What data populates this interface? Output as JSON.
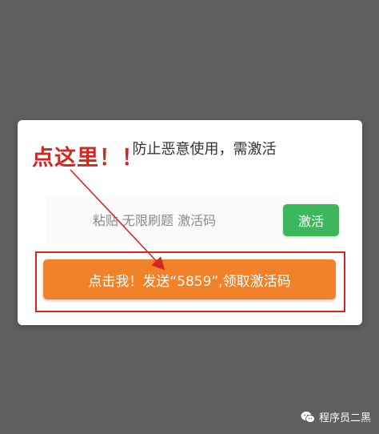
{
  "dialog": {
    "title": "防止恶意使用，需激活",
    "input_placeholder": "粘贴 无限刷题 激活码",
    "activate_label": "激活",
    "get_code_label": "点击我！发送“5859”,领取激活码"
  },
  "annotation": {
    "callout_text": "点这里！！",
    "highlight_color": "#d2281e"
  },
  "watermark": {
    "icon": "wechat-icon",
    "text": "程序员二黑"
  },
  "colors": {
    "background": "#5f5f5f",
    "activate_button": "#3cb85c",
    "get_code_button": "#f2822a",
    "annotation_red": "#d4271f"
  }
}
